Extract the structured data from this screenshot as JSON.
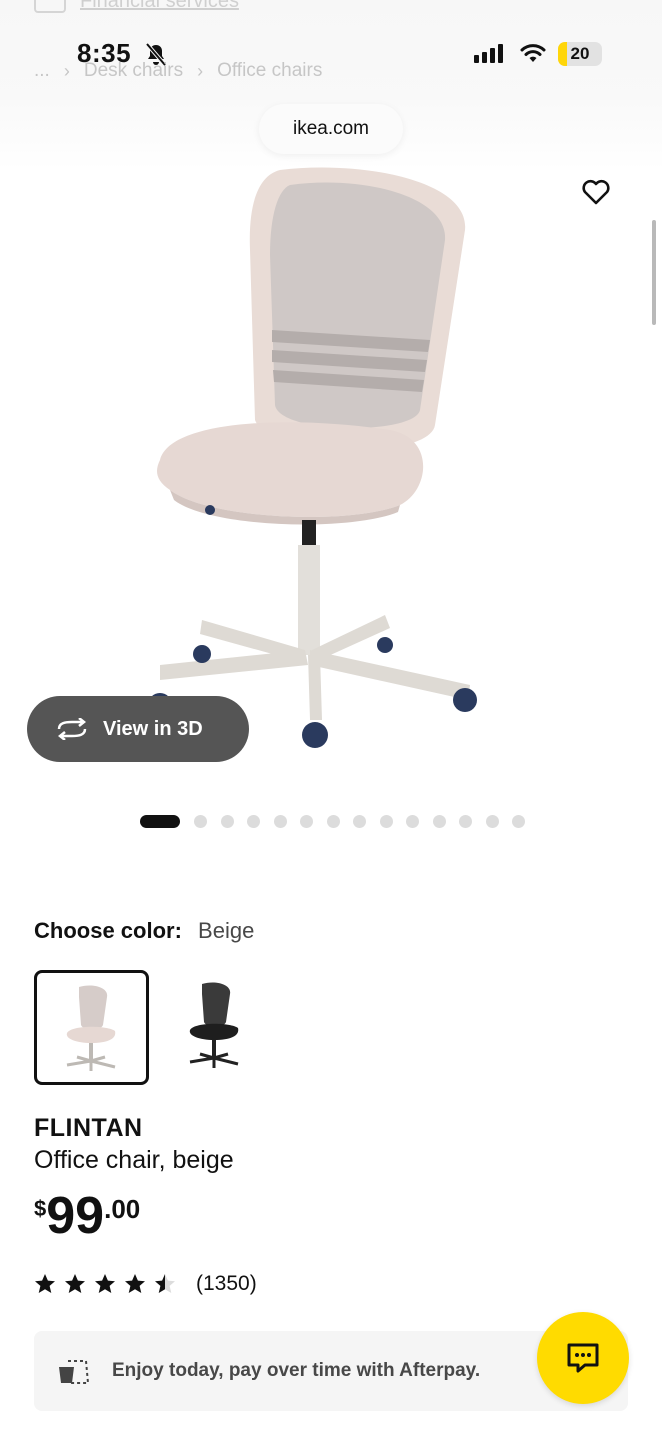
{
  "browser": {
    "ghost_link": "Financial services",
    "url": "ikea.com"
  },
  "status_bar": {
    "time": "8:35",
    "battery": "20",
    "battery_level": 0.2
  },
  "breadcrumb": {
    "more": "...",
    "items": [
      "Desk chairs",
      "Office chairs"
    ]
  },
  "gallery": {
    "view_3d_label": "View in 3D",
    "image_count": 14,
    "active_index": 0
  },
  "color_picker": {
    "label": "Choose color:",
    "selected": "Beige",
    "options": [
      {
        "name": "beige",
        "color": "#e6d8d3"
      },
      {
        "name": "black",
        "color": "#2b2b2b"
      }
    ]
  },
  "product": {
    "name": "FLINTAN",
    "description": "Office chair, beige",
    "price_currency": "$",
    "price_integer": "99",
    "price_decimal": ".00",
    "rating": 4.5,
    "review_count": "(1350)"
  },
  "afterpay": {
    "text": "Enjoy today, pay over time with Afterpay."
  },
  "colors": {
    "accent_yellow": "#ffdb00",
    "dark_pill": "#555555"
  }
}
